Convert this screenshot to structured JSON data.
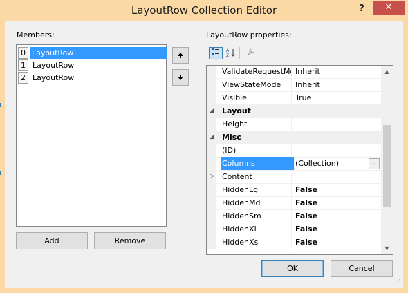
{
  "window": {
    "title": "LayoutRow Collection Editor",
    "help_label": "?",
    "close_label": "✕"
  },
  "members": {
    "label": "Members:",
    "items": [
      {
        "index": "0",
        "name": "LayoutRow"
      },
      {
        "index": "1",
        "name": "LayoutRow"
      },
      {
        "index": "2",
        "name": "LayoutRow"
      }
    ],
    "move_up_icon": "up-arrow-icon",
    "move_down_icon": "down-arrow-icon",
    "add_label": "Add",
    "remove_label": "Remove"
  },
  "properties": {
    "label": "LayoutRow properties:",
    "toolbar": [
      "categorized-icon",
      "alphabetical-icon",
      "property-pages-icon"
    ],
    "rows": [
      {
        "name": "ValidateRequestMc",
        "value": "Inherit"
      },
      {
        "name": "ViewStateMode",
        "value": "Inherit"
      },
      {
        "name": "Visible",
        "value": "True"
      },
      {
        "name": "Layout",
        "category": true
      },
      {
        "name": "Height",
        "value": ""
      },
      {
        "name": "Misc",
        "category": true
      },
      {
        "name": "(ID)",
        "value": ""
      },
      {
        "name": "Columns",
        "value": "(Collection)",
        "ellipsis": "...",
        "selected": true
      },
      {
        "name": "Content",
        "value": "",
        "expandable": true
      },
      {
        "name": "HiddenLg",
        "value": "False"
      },
      {
        "name": "HiddenMd",
        "value": "False"
      },
      {
        "name": "HiddenSm",
        "value": "False"
      },
      {
        "name": "HiddenXl",
        "value": "False"
      },
      {
        "name": "HiddenXs",
        "value": "False"
      }
    ]
  },
  "footer": {
    "ok_label": "OK",
    "cancel_label": "Cancel"
  },
  "colors": {
    "title_bar": "#fbd9a4",
    "close_button": "#c7504b",
    "selection": "#3399ff"
  }
}
